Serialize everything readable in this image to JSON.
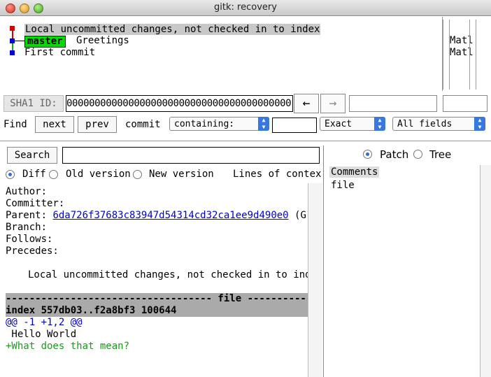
{
  "window": {
    "title": "gitk: recovery"
  },
  "colors": {
    "graph_line": "#11aa11",
    "branch_bg": "#00dd00",
    "red_dot": "#dd0000",
    "blue_dot": "#0000dd",
    "link": "#0000d0",
    "added": "#1a9a1a"
  },
  "commits": {
    "c0": "Local uncommitted changes, not checked in to index",
    "branch": "master",
    "c1": "Greetings",
    "c2": "First commit"
  },
  "author_col": {
    "r1": "Matl",
    "r2": "Matl"
  },
  "sha": {
    "label": "SHA1 ID:",
    "value": "0000000000000000000000000000000000000000",
    "back_icon": "left-arrow-icon",
    "forward_icon": "right-arrow-icon"
  },
  "find": {
    "label": "Find",
    "next": "next",
    "prev": "prev",
    "commit_label": "commit",
    "mode": "containing:",
    "match": "Exact",
    "fields": "All fields"
  },
  "search": {
    "button": "Search",
    "value": ""
  },
  "diffopts": {
    "diff": "Diff",
    "old_version": "Old version",
    "new_version": "New version",
    "lines_of_context": "Lines of context"
  },
  "view": {
    "patch": "Patch",
    "tree": "Tree"
  },
  "details": {
    "author": "Author:",
    "committer": "Committer:",
    "parent_label": "Parent:",
    "parent_hash": "6da726f37683c83947d54314cd32ca1ee9d490e0",
    "parent_suffix": "(Gree",
    "branch": "Branch:",
    "follows": "Follows:",
    "precedes": "Precedes:",
    "message": "Local uncommitted changes, not checked in to index",
    "file_header": "----------------------------------- file -----------",
    "index_line": "index 557db03..f2a8bf3 100644",
    "hunk": "@@ -1 +1,2 @@",
    "context_line": " Hello World",
    "added_line": "+What does that mean?"
  },
  "files": {
    "comments": "Comments",
    "file": "file"
  }
}
